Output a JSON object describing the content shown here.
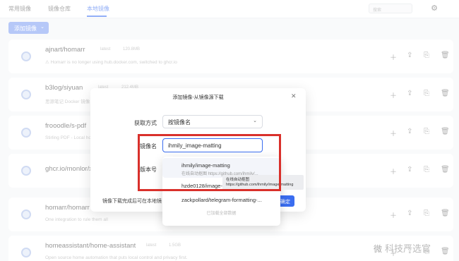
{
  "topbar": {
    "tabs": [
      {
        "label": "常用镜像"
      },
      {
        "label": "镜像仓库"
      },
      {
        "label": "本地镜像"
      }
    ],
    "search_placeholder": "搜索",
    "settings_icon": "gear-icon"
  },
  "toolbar": {
    "add_label": "添加镜像"
  },
  "cards": [
    {
      "name": "ajnart/homarr",
      "meta1": "latest",
      "meta2": "120.8MB",
      "desc": "⚠ Homarr is no longer using hub.docker.com, switched to ghcr.io"
    },
    {
      "name": "b3log/siyuan",
      "meta1": "latest",
      "meta2": "212.4MB",
      "desc": "思源笔记 Docker 镜像 ..."
    },
    {
      "name": "frooodle/s-pdf",
      "meta1": "latest",
      "meta2": "",
      "desc": "Stirling PDF - Local hosted web application ..."
    },
    {
      "name": "ghcr.io/monlor/x",
      "meta1": "",
      "meta2": "",
      "desc": ""
    },
    {
      "name": "homarr/homarr",
      "meta1": "latest",
      "meta2": "",
      "desc": "One integration to rule them all"
    },
    {
      "name": "homeassistant/home-assistant",
      "meta1": "latest",
      "meta2": "1.5GB",
      "desc": "Open source home automation that puts local control and privacy first."
    }
  ],
  "modal": {
    "title": "添加镜像-从镜像源下载",
    "method_label": "获取方式",
    "method_value": "按镜像名",
    "name_label": "镜像名",
    "name_value": "ihmily_image-matting",
    "version_label": "版本号",
    "footer_note": "镜像下载完成后可在本地镜",
    "confirm_label": "确定"
  },
  "dropdown": {
    "options": [
      {
        "title": "ihmily/image-matting",
        "sub": "在线自动抠图 https://github.com/ihmily/..."
      },
      {
        "title": "hzde0128/image-",
        "sub": ""
      },
      {
        "title": "zackpollard/telegram-formatting-...",
        "sub": ""
      }
    ],
    "loaded_text": "已加载全部数据"
  },
  "tooltip": {
    "line1": "在线自动抠图",
    "line2": "https://github.com/ihmily/image-matting"
  },
  "watermark": {
    "logo": "微",
    "text": "科技严选官"
  },
  "colors": {
    "accent": "#3a6df0",
    "highlight": "#d9302b"
  }
}
